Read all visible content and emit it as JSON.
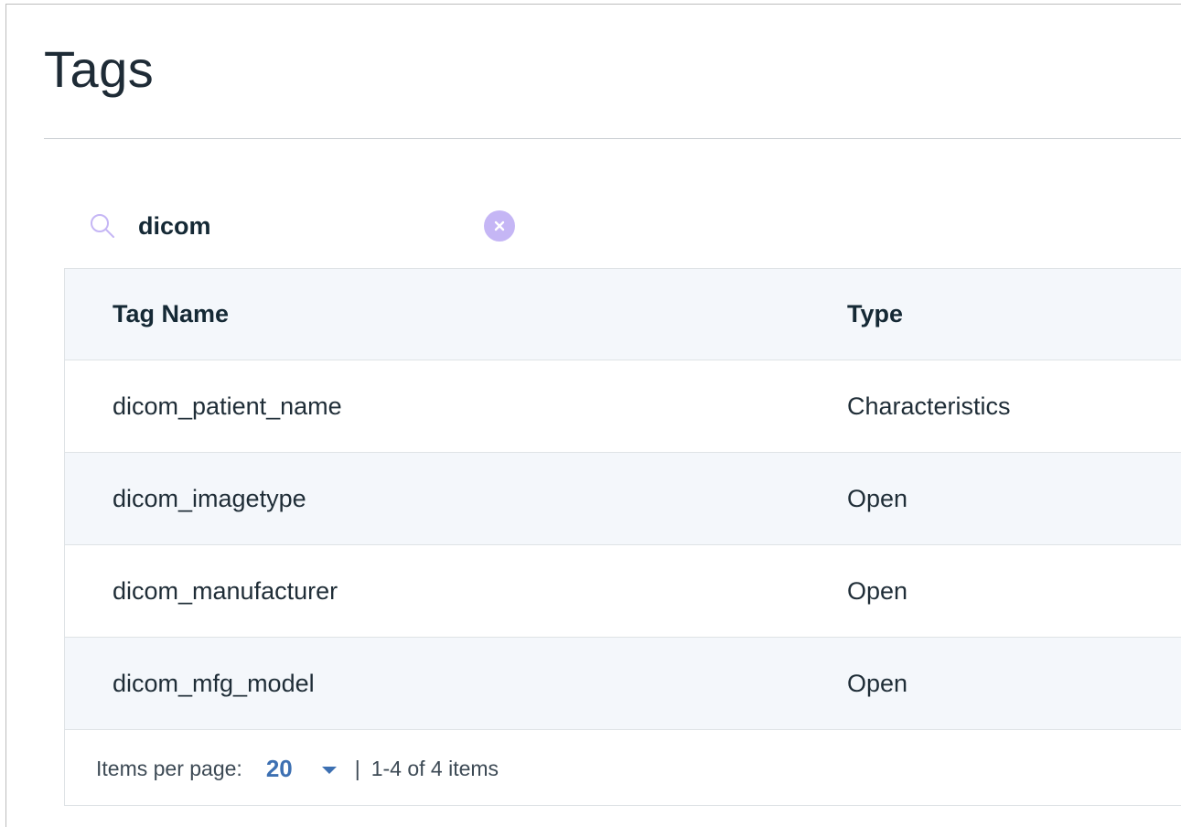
{
  "page": {
    "title": "Tags"
  },
  "search": {
    "value": "dicom",
    "icon": "search-icon",
    "clear_icon": "close-icon",
    "accent_color": "#c5b6f5"
  },
  "table": {
    "columns": [
      "Tag Name",
      "Type"
    ],
    "rows": [
      {
        "name": "dicom_patient_name",
        "type": "Characteristics"
      },
      {
        "name": "dicom_imagetype",
        "type": "Open"
      },
      {
        "name": "dicom_manufacturer",
        "type": "Open"
      },
      {
        "name": "dicom_mfg_model",
        "type": "Open"
      }
    ]
  },
  "pagination": {
    "items_per_page_label": "Items per page:",
    "items_per_page_value": "20",
    "separator": "|",
    "range_text": "1-4 of 4 items",
    "accent_color": "#3d70b2"
  }
}
